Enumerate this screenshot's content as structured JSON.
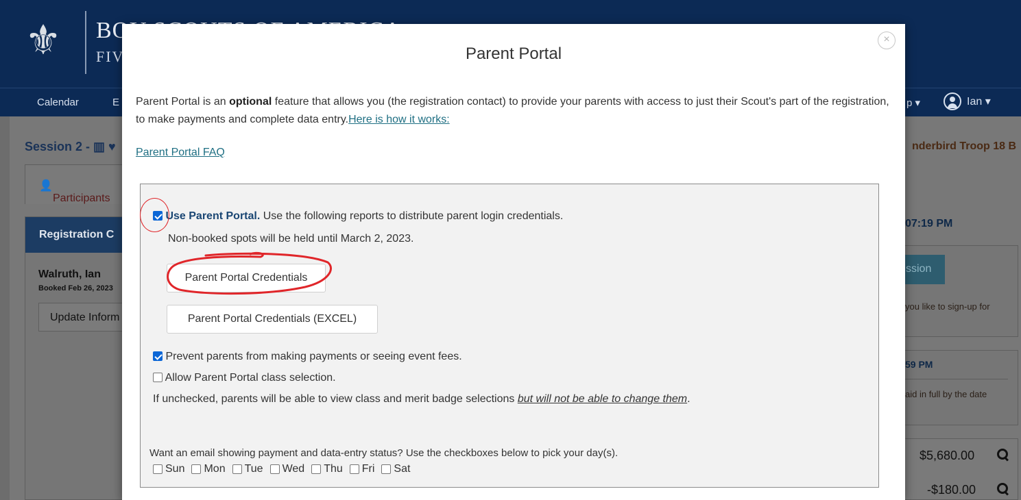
{
  "background": {
    "brand_line1": "BOY SCOUTS OF AMERICA",
    "brand_line2": "FIVE",
    "nav": {
      "calendar": "Calendar",
      "events": "E",
      "help": "p ▾",
      "user_name": "Ian ▾"
    },
    "session_title": "Session 2 - ▥ ♥",
    "tab_participants": "Participants",
    "registration_heading": "Registration C",
    "registrant_name": "Walruth, Ian",
    "booked_text": "Booked Feb 26, 2023",
    "update_button": "Update Inform",
    "troop_name": "nderbird Troop 18 B",
    "time1": "07:19 PM",
    "session_button": "ssion",
    "signup_text": "you like to sign-up for",
    "time2": "59 PM",
    "paid_text": "aid in full by the date",
    "amount1": "$5,680.00",
    "amount2": "-$180.00"
  },
  "modal": {
    "close_symbol": "×",
    "title": "Parent Portal",
    "intro_pre": "Parent Portal is an ",
    "intro_bold": "optional",
    "intro_post": " feature that allows you (the registration contact) to provide your parents with access to just their Scout's part of the registration, to make payments and complete data entry.",
    "how_link": "Here is how it works:",
    "faq_link": "Parent Portal FAQ",
    "settings": {
      "use_portal_checked": true,
      "use_portal_label": "Use Parent Portal.",
      "use_portal_desc": " Use the following reports to distribute parent login credentials.",
      "held_text": "Non-booked spots will be held until March 2, 2023.",
      "credentials_button": "Parent Portal Credentials",
      "credentials_excel_button": "Parent Portal Credentials (EXCEL)",
      "prevent_checked": true,
      "prevent_label": "Prevent parents from making payments or seeing event fees.",
      "allow_class_checked": false,
      "allow_class_label": "Allow Parent Portal class selection.",
      "uncheck_pre": "If unchecked, parents will be able to view class and merit badge selections ",
      "uncheck_em": "but will not be able to change them",
      "uncheck_post": ".",
      "email_prompt": "Want an email showing payment and data-entry status? Use the checkboxes below to pick your day(s).",
      "days": [
        "Sun",
        "Mon",
        "Tue",
        "Wed",
        "Thu",
        "Fri",
        "Sat"
      ]
    }
  },
  "colors": {
    "header_navy": "#0c2a55",
    "link_teal": "#1f6f83",
    "checkbox_blue": "#0b66d6",
    "annotation_red": "#e0262a"
  }
}
